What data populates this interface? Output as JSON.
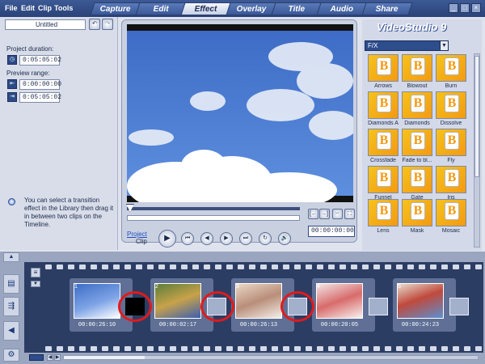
{
  "menu": [
    "File",
    "Edit",
    "Clip",
    "Tools"
  ],
  "tabs": [
    "Capture",
    "Edit",
    "Effect",
    "Overlay",
    "Title",
    "Audio",
    "Share"
  ],
  "active_tab": "Effect",
  "window_buttons": [
    "_",
    "□",
    "×"
  ],
  "left": {
    "project_name": "Untitled",
    "project_duration_label": "Project duration:",
    "project_duration": "0:05:05:02",
    "preview_range_label": "Preview range:",
    "range_start": "0:00:00:00",
    "range_end": "0:05:05:02",
    "hint": "You can select a transition effect in the Library then drag it in between two clips on the Timeline."
  },
  "preview": {
    "project_label": "Project",
    "clip_label": "Clip",
    "timecode": "00:00:00:00"
  },
  "library": {
    "logo": "VideoStudio 9",
    "category": "F/X",
    "items": [
      "Arrows",
      "Blowout",
      "Burn",
      "Diamonds A",
      "Diamonds",
      "Dissolve",
      "Crossfade",
      "Fade to bl...",
      "Fly",
      "Funnel",
      "Gate",
      "Iris",
      "Lens",
      "Mask",
      "Mosaic"
    ]
  },
  "timeline": {
    "clips": [
      {
        "num": "1",
        "tc": "00:00:26:10"
      },
      {
        "num": "2",
        "tc": "00:00:02:17"
      },
      {
        "num": "3",
        "tc": "00:00:26:13"
      },
      {
        "num": "4",
        "tc": "00:00:20:05"
      },
      {
        "num": "5",
        "tc": "00:00:24:23"
      }
    ]
  },
  "colors": {
    "accent": "#3b5898",
    "highlight_ring": "#e11a1a"
  }
}
